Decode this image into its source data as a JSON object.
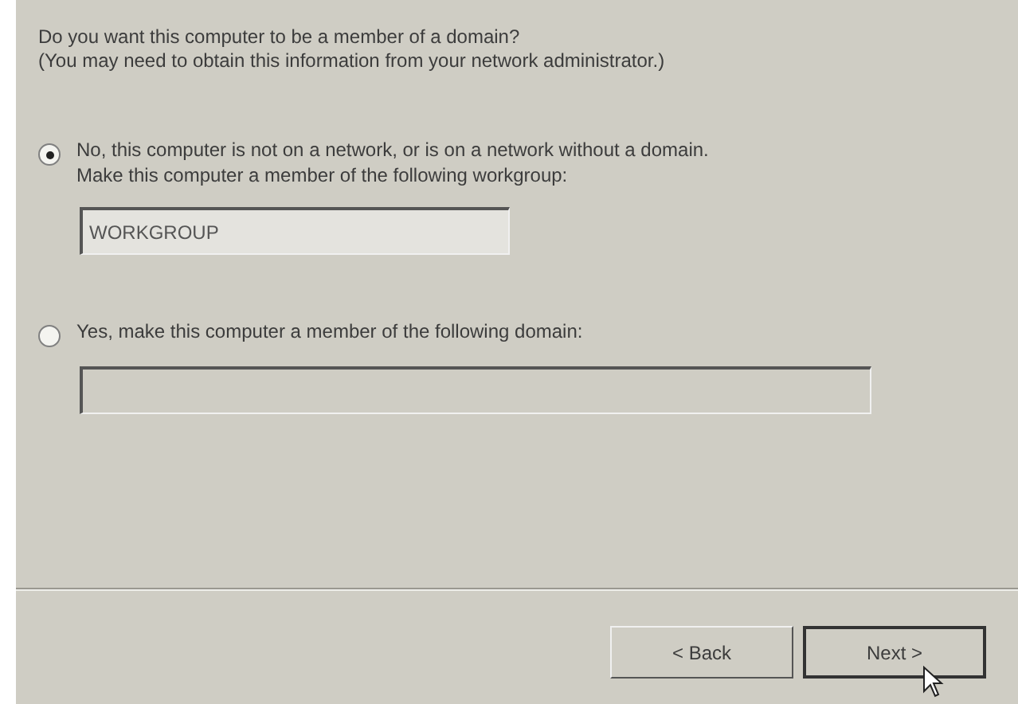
{
  "header": {
    "question": "Do you want this computer to be a member of a domain?",
    "note": "(You may need to obtain this information from your network administrator.)"
  },
  "options": [
    {
      "label": "No, this computer is not on a network, or is on a network without a domain.\nMake this computer a member of the following workgroup:",
      "selected": true,
      "field": {
        "value": "WORKGROUP",
        "disabled": false
      }
    },
    {
      "label": "Yes, make this computer a member of the following domain:",
      "selected": false,
      "field": {
        "disabled": true
      }
    }
  ],
  "buttons": [
    {
      "label": "< Back",
      "default": false
    },
    {
      "label": "Next >",
      "default": true
    }
  ]
}
